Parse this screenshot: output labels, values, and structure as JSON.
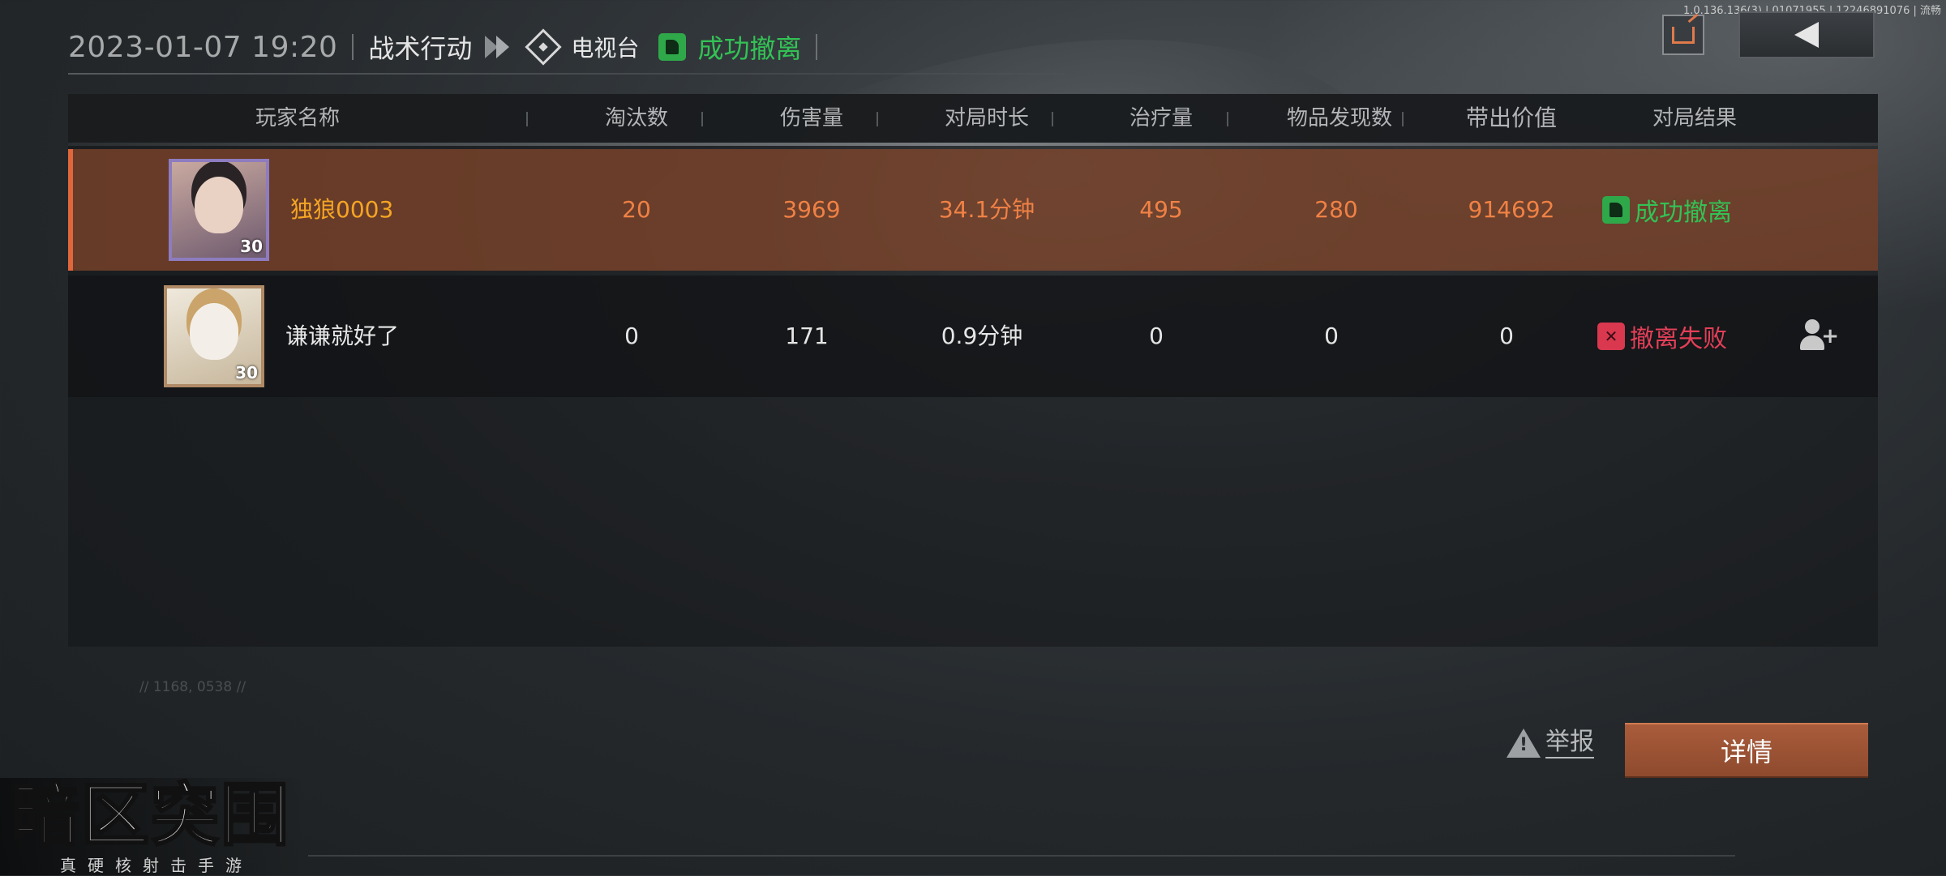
{
  "header": {
    "datetime": "2023-01-07 19:20",
    "mode": "战术行动",
    "map": "电视台",
    "status": "成功撤离",
    "watermark": "1.0.136.136(3) | 01071955 | 12246891076 | 流畅"
  },
  "table": {
    "columns": [
      "玩家名称",
      "淘汰数",
      "伤害量",
      "对局时长",
      "治疗量",
      "物品发现数",
      "带出价值",
      "对局结果"
    ],
    "rows": [
      {
        "name": "独狼0003",
        "level": "30",
        "kills": "20",
        "damage": "3969",
        "duration": "34.1分钟",
        "healing": "495",
        "items": "280",
        "value": "914692",
        "result": "成功撤离",
        "result_type": "success"
      },
      {
        "name": "谦谦就好了",
        "level": "30",
        "kills": "0",
        "damage": "171",
        "duration": "0.9分钟",
        "healing": "0",
        "items": "0",
        "value": "0",
        "result": "撤离失败",
        "result_type": "fail"
      }
    ]
  },
  "footer": {
    "coords": "// 1168, 0538 //",
    "report_label": "举报",
    "details_label": "详情",
    "logo_main": "暗区突围",
    "logo_sub": "真硬核射击手游"
  },
  "icons": {
    "share": "share-icon",
    "back": "back-arrow-icon",
    "map": "map-diamond-icon",
    "success": "thumb-up-icon",
    "fail": "fail-icon",
    "add_friend": "add-friend-icon",
    "report": "warning-icon"
  },
  "colors": {
    "success": "#33c255",
    "fail": "#e43f58",
    "highlight_row": "#964e2c",
    "accent_orange": "#f08145",
    "player_name": "#f5a524",
    "details_button": "#a95c3b"
  }
}
